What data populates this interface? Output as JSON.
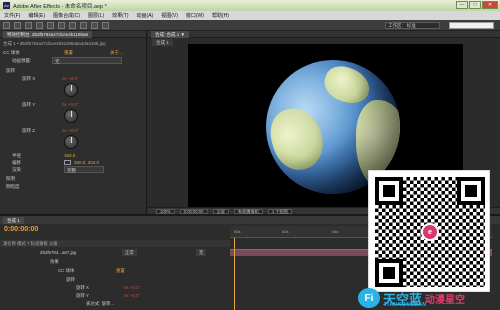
{
  "window": {
    "title": "Adobe After Effects - 未命名项目.aep *",
    "logo": "Ae",
    "min": "—",
    "max": "□",
    "close": "✕"
  },
  "menu": [
    "文件(F)",
    "编辑(E)",
    "图像合成(C)",
    "图层(L)",
    "效果(T)",
    "动画(A)",
    "视图(V)",
    "窗口(W)",
    "帮助(H)"
  ],
  "toolbar": {
    "workspace_label": "工作区:",
    "workspace_value": "标准"
  },
  "effects_panel": {
    "tab": "特效控制台: d53f6784a27d1ee4b1185a6",
    "layer_path": "合成 1 • d53f6784a27d1ee4b91185a6a4da3185.jpg",
    "effect_name": "CC 球体",
    "reset": "重置",
    "about": "关于...",
    "render_label": "动画预置:",
    "render_value": "无",
    "rotation": "旋转",
    "rot_x_label": "旋转 X",
    "rot_x_value": "0x +0.0°",
    "rot_y_label": "旋转 Y",
    "rot_y_value": "0x +0.0°",
    "rot_z_label": "旋转 Z",
    "rot_z_value": "0x +0.0°",
    "radius_label": "半径",
    "radius_value": "150.0",
    "offset_label": "偏移",
    "offset_value": "360.0, 204.0",
    "render_mode_label": "渲染",
    "render_mode_value": "完整",
    "light_label": "照明",
    "shading_label": "明暗度"
  },
  "comp_panel": {
    "tab": "合成: 合成 1 ▼",
    "subtab": "合成 1",
    "zoom": "100%",
    "timecode": "0:00:00:00",
    "resolution": "全屏",
    "camera": "有效摄像机",
    "views": "1 个视图"
  },
  "timeline": {
    "tab": "合成 1",
    "time": "0:00:00:00",
    "columns": "源名称 模式 T 轨道蒙板 父级",
    "ruler": [
      "00s",
      "02s",
      "04s",
      "06s",
      "08s",
      "10s"
    ],
    "layer": "d53f6784...a87.jpg",
    "layer_mode": "正常",
    "layer_parent": "无",
    "effects": "效果",
    "effect": "CC 球体",
    "reset": "重置",
    "rotation": "旋转",
    "rot_x": "旋转 X",
    "rot_x_value": "0x +0.0°",
    "rot_y": "旋转 Y",
    "rot_y_value": "0x +0.0°",
    "expr": "表达式: 旋转..."
  },
  "watermark": {
    "zh": "天空蓝",
    "zh2": "动漫星空",
    "en": "TIANKONGLAN",
    "logo": "Fi",
    "qr_logo": "e"
  }
}
